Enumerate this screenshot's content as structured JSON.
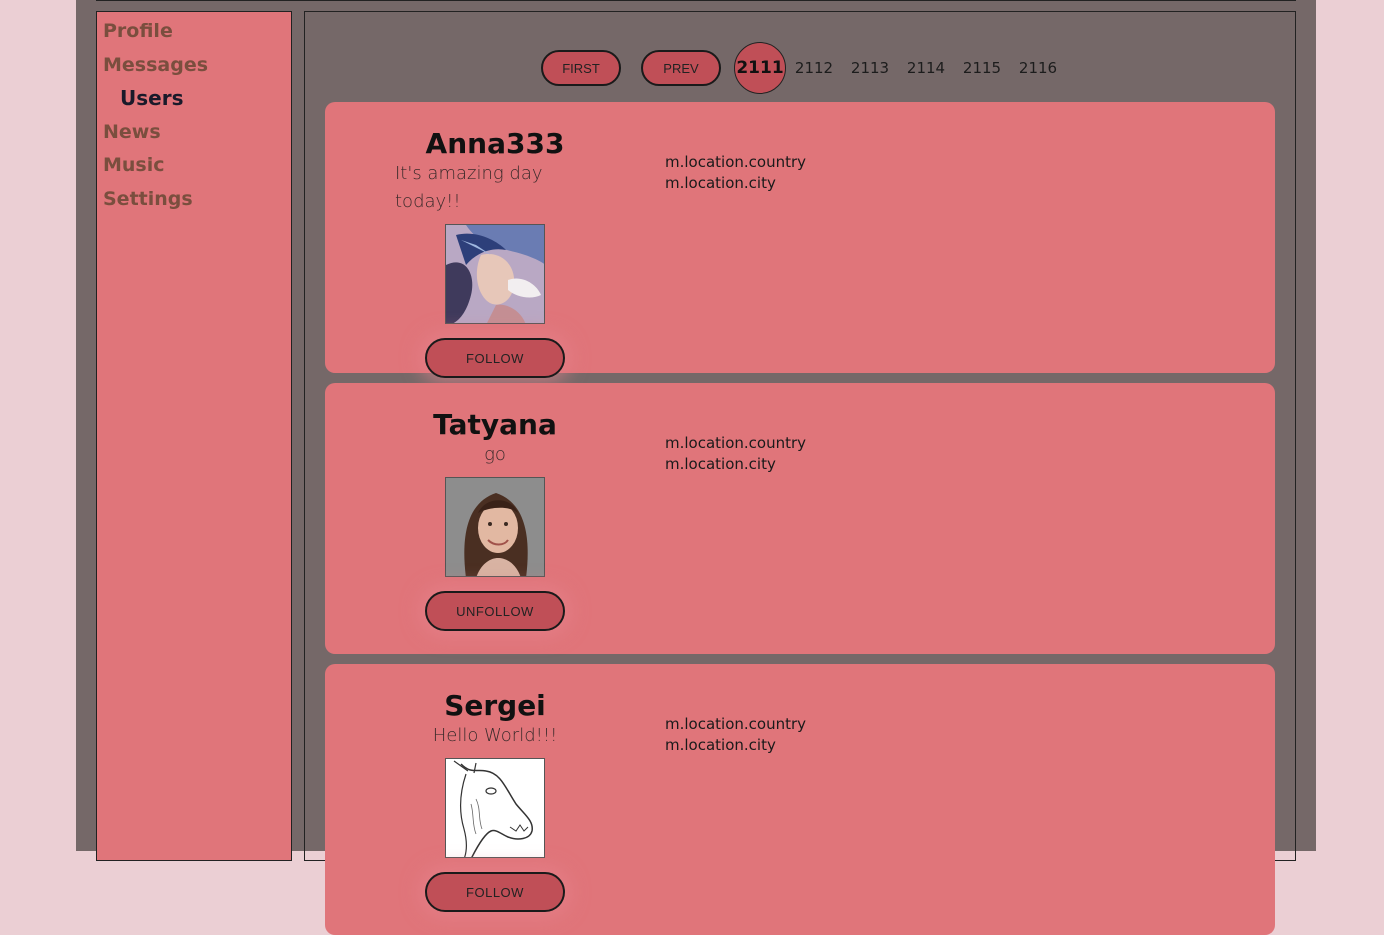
{
  "nav": {
    "items": [
      {
        "label": "Profile",
        "active": false
      },
      {
        "label": "Messages",
        "active": false
      },
      {
        "label": "Users",
        "active": true
      },
      {
        "label": "News",
        "active": false
      },
      {
        "label": "Music",
        "active": false
      },
      {
        "label": "Settings",
        "active": false
      }
    ]
  },
  "pager": {
    "first_label": "FIRST",
    "prev_label": "PREV",
    "current": "2111",
    "pages": [
      "2112",
      "2113",
      "2114",
      "2115",
      "2116"
    ]
  },
  "users": [
    {
      "name": "Anna333",
      "status": "It's amazing day today!!",
      "button": "FOLLOW",
      "country": "m.location.country",
      "city": "m.location.city",
      "avatar_icon": "painted-woman-with-bird"
    },
    {
      "name": "Tatyana",
      "status": "go",
      "button": "UNFOLLOW",
      "country": "m.location.country",
      "city": "m.location.city",
      "avatar_icon": "woman-portrait-photo"
    },
    {
      "name": "Sergei",
      "status": "Hello World!!!",
      "button": "FOLLOW",
      "country": "m.location.country",
      "city": "m.location.city",
      "avatar_icon": "horse-sketch"
    }
  ],
  "colors": {
    "page_bg": "#ebcfd4",
    "frame_bg": "#756868",
    "panel": "#e0757a",
    "button": "#c04f57",
    "nav_text": "#7a4e3e",
    "nav_active": "#1a1a2a"
  }
}
